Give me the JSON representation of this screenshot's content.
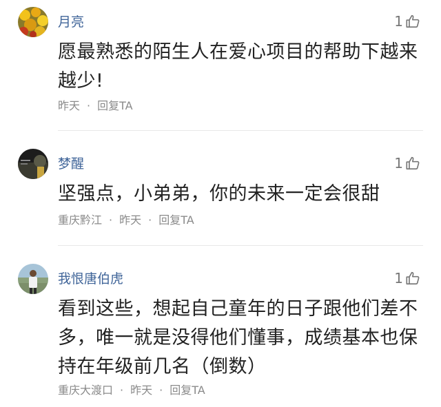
{
  "comments": [
    {
      "username": "月亮",
      "likes": "1",
      "text": "愿最熟悉的陌生人在爱心项目的帮助下越来越少!",
      "location": "",
      "time": "昨天",
      "reply": "回复TA",
      "avatar_icon": "avatar-yellow-flowers"
    },
    {
      "username": "梦醒",
      "likes": "1",
      "text": "坚强点，小弟弟，你的未来一定会很甜",
      "location": "重庆黔江",
      "time": "昨天",
      "reply": "回复TA",
      "avatar_icon": "avatar-dark-photo"
    },
    {
      "username": "我恨唐伯虎",
      "likes": "1",
      "text": "看到这些，想起自己童年的日子跟他们差不多，唯一就是没得他们懂事，成绩基本也保持在年级前几名（倒数）",
      "location": "重庆大渡口",
      "time": "昨天",
      "reply": "回复TA",
      "avatar_icon": "avatar-person-outdoors"
    }
  ],
  "separator": "·",
  "icons": {
    "like": "thumbs-up-icon"
  },
  "colors": {
    "username": "#406599",
    "content": "#222222",
    "meta": "#8a8a8a",
    "divider": "#e8e8e8"
  }
}
